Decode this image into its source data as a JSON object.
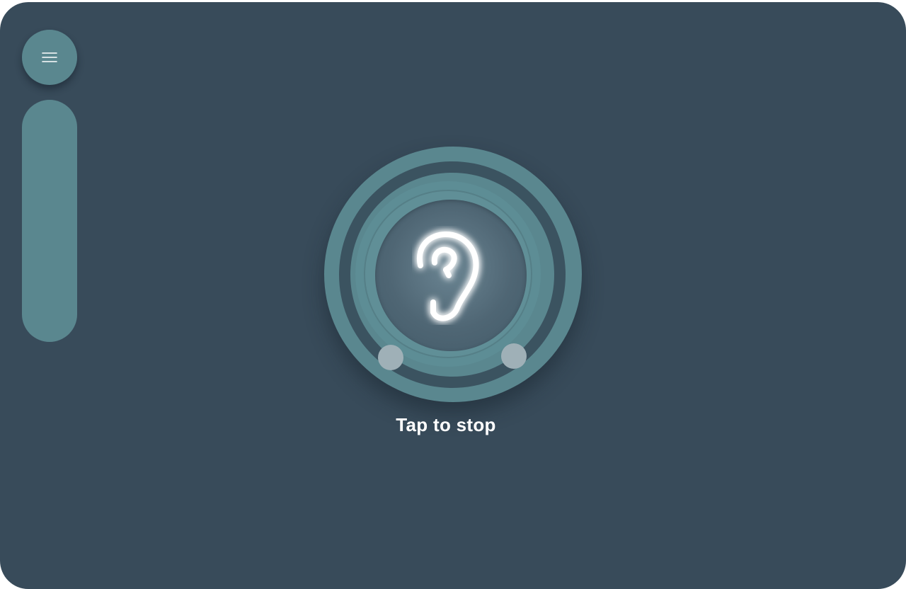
{
  "app": {
    "background_color": "#384b5a",
    "accent_color": "#5a878f",
    "glow_color": "#ffffff"
  },
  "menu": {
    "icon": "hamburger-menu-icon"
  },
  "listening": {
    "icon": "ear-icon",
    "status_text": "Tap to stop"
  }
}
